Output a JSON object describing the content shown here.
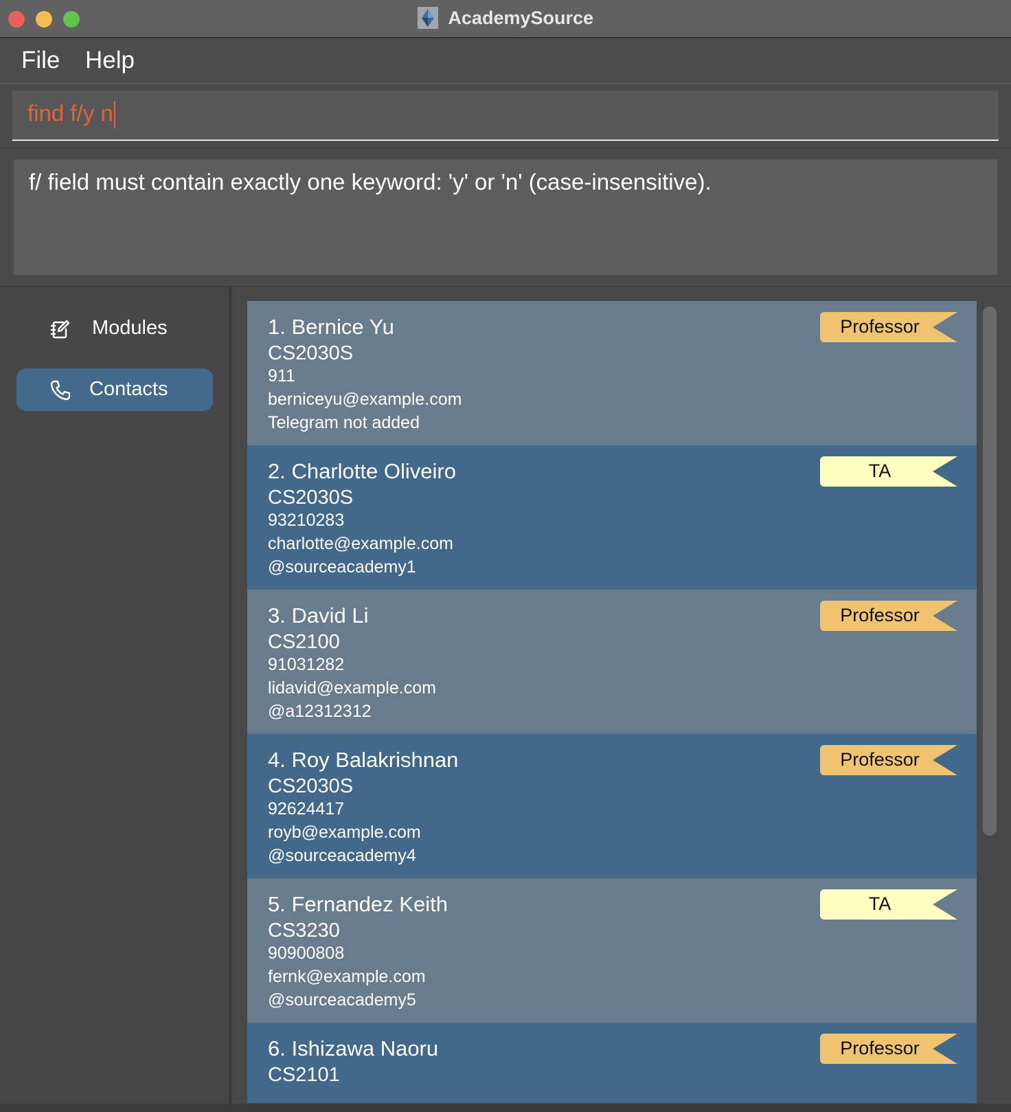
{
  "window": {
    "title": "AcademySource",
    "app_icon": "academy-diamond-icon"
  },
  "menu": {
    "file_label": "File",
    "help_label": "Help"
  },
  "command": {
    "value": "find f/y n"
  },
  "result": {
    "message": "f/ field must contain exactly one keyword: 'y' or 'n' (case-insensitive)."
  },
  "sidebar": {
    "items": [
      {
        "label": "Modules",
        "icon": "edit-note-icon",
        "selected": false
      },
      {
        "label": "Contacts",
        "icon": "phone-icon",
        "selected": true
      }
    ],
    "selected_color": "#436a8d"
  },
  "colors": {
    "professor_badge": "#f0c36e",
    "ta_badge": "#ffffc0",
    "card_light": "#687c8e",
    "card_dark": "#42698c",
    "command_text": "#e0633e"
  },
  "contacts": [
    {
      "name": "1. Bernice Yu",
      "module": "CS2030S",
      "phone": "911",
      "email": "berniceyu@example.com",
      "telegram": "Telegram not added",
      "role": "Professor"
    },
    {
      "name": "2. Charlotte Oliveiro",
      "module": "CS2030S",
      "phone": "93210283",
      "email": "charlotte@example.com",
      "telegram": "@sourceacademy1",
      "role": "TA"
    },
    {
      "name": "3. David Li",
      "module": "CS2100",
      "phone": "91031282",
      "email": "lidavid@example.com",
      "telegram": "@a12312312",
      "role": "Professor"
    },
    {
      "name": "4. Roy Balakrishnan",
      "module": "CS2030S",
      "phone": "92624417",
      "email": "royb@example.com",
      "telegram": "@sourceacademy4",
      "role": "Professor"
    },
    {
      "name": "5. Fernandez Keith",
      "module": "CS3230",
      "phone": "90900808",
      "email": "fernk@example.com",
      "telegram": "@sourceacademy5",
      "role": "TA"
    },
    {
      "name": "6. Ishizawa Naoru",
      "module": "CS2101",
      "role": "Professor"
    }
  ]
}
